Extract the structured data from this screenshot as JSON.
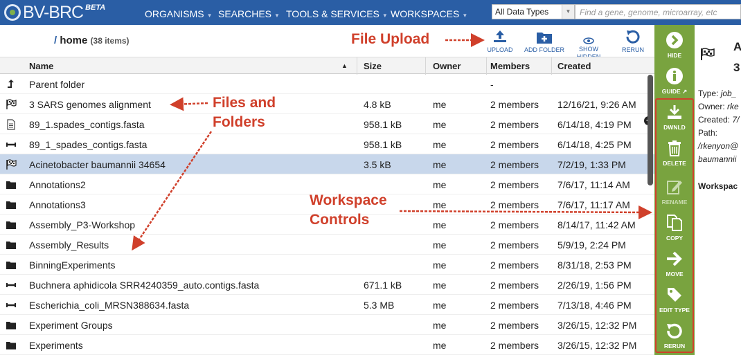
{
  "header": {
    "brand": "BV-BRC",
    "beta": "BETA",
    "nav": [
      "ORGANISMS",
      "SEARCHES",
      "TOOLS & SERVICES",
      "WORKSPACES"
    ],
    "data_type": "All Data Types",
    "search_placeholder": "Find a gene, genome, microarray, etc"
  },
  "breadcrumb": {
    "slash": "/",
    "path": "home",
    "count": "(38 items)"
  },
  "toolbar": {
    "upload": "UPLOAD",
    "add_folder": "ADD FOLDER",
    "show_hidden_1": "SHOW",
    "show_hidden_2": "HIDDEN",
    "rerun": "RERUN"
  },
  "columns": {
    "name": "Name",
    "size": "Size",
    "owner": "Owner",
    "members": "Members",
    "created": "Created"
  },
  "parent": {
    "name": "Parent folder",
    "members": "-"
  },
  "rows": [
    {
      "icon": "flag",
      "name": "3 SARS genomes alignment",
      "size": "4.8 kB",
      "owner": "me",
      "members": "2 members",
      "created": "12/16/21, 9:26 AM"
    },
    {
      "icon": "doc",
      "name": "89_1.spades_contigs.fasta",
      "size": "958.1 kB",
      "owner": "me",
      "members": "2 members",
      "created": "6/14/18, 4:19 PM"
    },
    {
      "icon": "contig",
      "name": "89_1_spades_contigs.fasta",
      "size": "958.1 kB",
      "owner": "me",
      "members": "2 members",
      "created": "6/14/18, 4:25 PM"
    },
    {
      "icon": "flag",
      "name": "Acinetobacter baumannii 34654",
      "size": "3.5 kB",
      "owner": "me",
      "members": "2 members",
      "created": "7/2/19, 1:33 PM",
      "selected": true
    },
    {
      "icon": "folder",
      "name": "Annotations2",
      "size": "",
      "owner": "me",
      "members": "2 members",
      "created": "7/6/17, 11:14 AM"
    },
    {
      "icon": "folder",
      "name": "Annotations3",
      "size": "",
      "owner": "me",
      "members": "2 members",
      "created": "7/6/17, 11:17 AM"
    },
    {
      "icon": "folder",
      "name": "Assembly_P3-Workshop",
      "size": "",
      "owner": "me",
      "members": "2 members",
      "created": "8/14/17, 11:42 AM"
    },
    {
      "icon": "folder",
      "name": "Assembly_Results",
      "size": "",
      "owner": "me",
      "members": "2 members",
      "created": "5/9/19, 2:24 PM"
    },
    {
      "icon": "folder",
      "name": "BinningExperiments",
      "size": "",
      "owner": "me",
      "members": "2 members",
      "created": "8/31/18, 2:53 PM"
    },
    {
      "icon": "contig",
      "name": "Buchnera aphidicola SRR4240359_auto.contigs.fasta",
      "size": "671.1 kB",
      "owner": "me",
      "members": "2 members",
      "created": "2/26/19, 1:56 PM"
    },
    {
      "icon": "contig",
      "name": "Escherichia_coli_MRSN388634.fasta",
      "size": "5.3 MB",
      "owner": "me",
      "members": "2 members",
      "created": "7/13/18, 4:46 PM"
    },
    {
      "icon": "folder",
      "name": "Experiment Groups",
      "size": "",
      "owner": "me",
      "members": "2 members",
      "created": "3/26/15, 12:32 PM"
    },
    {
      "icon": "folder",
      "name": "Experiments",
      "size": "",
      "owner": "me",
      "members": "2 members",
      "created": "3/26/15, 12:32 PM"
    }
  ],
  "side_actions": [
    {
      "name": "hide",
      "label": "HIDE",
      "enabled": true
    },
    {
      "name": "guide",
      "label": "GUIDE",
      "enabled": true
    },
    {
      "name": "download",
      "label": "DWNLD",
      "enabled": true
    },
    {
      "name": "delete",
      "label": "DELETE",
      "enabled": true
    },
    {
      "name": "rename",
      "label": "RENAME",
      "enabled": false
    },
    {
      "name": "copy",
      "label": "COPY",
      "enabled": true
    },
    {
      "name": "move",
      "label": "MOVE",
      "enabled": true
    },
    {
      "name": "edit-type",
      "label": "EDIT TYPE",
      "enabled": true
    },
    {
      "name": "rerun",
      "label": "RERUN",
      "enabled": true
    }
  ],
  "info_panel": {
    "title_initial": "A",
    "title_line2": "3",
    "type": "Type:",
    "type_val": "job_",
    "owner": "Owner:",
    "owner_val": "rke",
    "created": "Created:",
    "created_val": "7/",
    "path": "Path:",
    "path_val1": "/rkenyon@",
    "path_val2": "baumannii",
    "workspace": "Workspac"
  },
  "annotations": {
    "file_upload": "File Upload",
    "files_folders_1": "Files and",
    "files_folders_2": "Folders",
    "controls_1": "Workspace",
    "controls_2": "Controls"
  },
  "colors": {
    "nav_bg": "#2a5ea5",
    "sidebar_green": "#79a33f",
    "annotation_red": "#d0402b",
    "selected_row": "#c8d7eb"
  }
}
